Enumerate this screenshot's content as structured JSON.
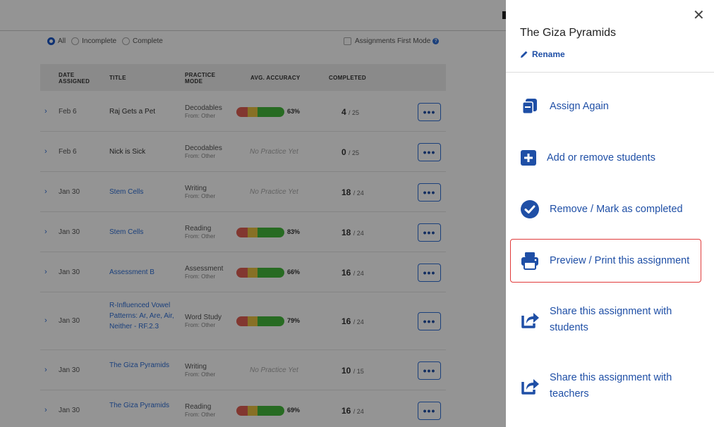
{
  "filters": {
    "options": [
      {
        "label": "All",
        "selected": true
      },
      {
        "label": "Incomplete",
        "selected": false
      },
      {
        "label": "Complete",
        "selected": false
      }
    ],
    "assignments_first_label": "Assignments First Mode"
  },
  "table": {
    "headers": {
      "date": "Date Assigned",
      "title": "Title",
      "mode": "Practice Mode",
      "accuracy": "Avg. Accuracy",
      "completed": "Completed"
    },
    "rows": [
      {
        "date": "Feb 6",
        "title": "Raj Gets a Pet",
        "title_link": false,
        "mode": "Decodables",
        "source": "From: Other",
        "accuracy": 63,
        "accuracy_label": "63%",
        "no_practice": "",
        "done": "4",
        "total": "/ 25",
        "more": "•••"
      },
      {
        "date": "Feb 6",
        "title": "Nick is Sick",
        "title_link": false,
        "mode": "Decodables",
        "source": "From: Other",
        "accuracy": null,
        "accuracy_label": "",
        "no_practice": "No Practice Yet",
        "done": "0",
        "total": "/ 25",
        "more": "•••"
      },
      {
        "date": "Jan 30",
        "title": "Stem Cells",
        "title_link": true,
        "mode": "Writing",
        "source": "From: Other",
        "accuracy": null,
        "accuracy_label": "",
        "no_practice": "No Practice Yet",
        "done": "18",
        "total": "/ 24",
        "more": "•••"
      },
      {
        "date": "Jan 30",
        "title": "Stem Cells",
        "title_link": true,
        "mode": "Reading",
        "source": "From: Other",
        "accuracy": 83,
        "accuracy_label": "83%",
        "no_practice": "",
        "done": "18",
        "total": "/ 24",
        "more": "•••"
      },
      {
        "date": "Jan 30",
        "title": "Assessment B",
        "title_link": true,
        "mode": "Assessment",
        "source": "From: Other",
        "accuracy": 66,
        "accuracy_label": "66%",
        "no_practice": "",
        "done": "16",
        "total": "/ 24",
        "more": "•••"
      },
      {
        "date": "Jan 30",
        "title": "R-Influenced Vowel Patterns: Ar, Are, Air, Neither - RF.2.3",
        "title_link": true,
        "mode": "Word Study",
        "source": "From: Other",
        "accuracy": 79,
        "accuracy_label": "79%",
        "no_practice": "",
        "done": "16",
        "total": "/ 24",
        "more": "•••"
      },
      {
        "date": "Jan 30",
        "title": "The Giza Pyramids",
        "title_link": true,
        "mode": "Writing",
        "source": "From: Other",
        "accuracy": null,
        "accuracy_label": "",
        "no_practice": "No Practice Yet",
        "done": "10",
        "total": "/ 15",
        "more": "•••"
      },
      {
        "date": "Jan 30",
        "title": "The Giza Pyramids",
        "title_link": true,
        "mode": "Reading",
        "source": "From: Other",
        "accuracy": 69,
        "accuracy_label": "69%",
        "no_practice": "",
        "done": "16",
        "total": "/ 24",
        "more": "•••"
      }
    ]
  },
  "panel": {
    "title": "The Giza Pyramids",
    "close": "✕",
    "rename": "Rename",
    "actions": [
      {
        "name": "assign-again",
        "icon": "copy-icon",
        "label": "Assign Again"
      },
      {
        "name": "add-remove-students",
        "icon": "plus-square-icon",
        "label": "Add or remove students"
      },
      {
        "name": "remove-mark-completed",
        "icon": "check-circle-icon",
        "label": "Remove / Mark as completed"
      },
      {
        "name": "preview-print",
        "icon": "printer-icon",
        "label": "Preview / Print this assignment"
      },
      {
        "name": "share-students",
        "icon": "share-icon",
        "label": "Share this assignment with students"
      },
      {
        "name": "share-teachers",
        "icon": "share-icon",
        "label": "Share this assignment with teachers"
      }
    ]
  }
}
